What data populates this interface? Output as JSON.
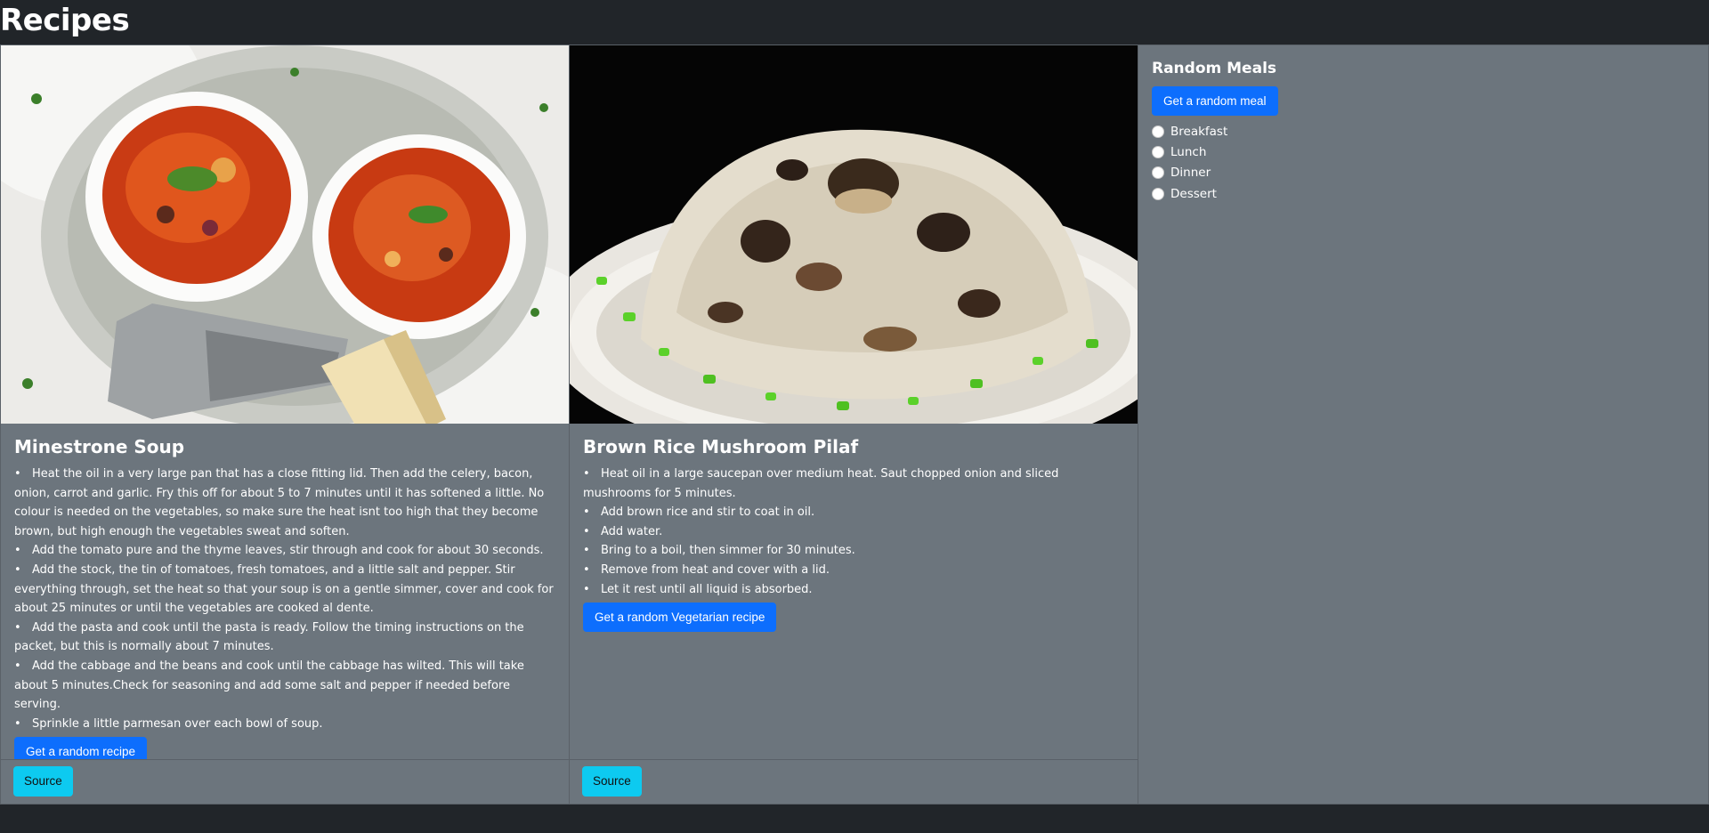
{
  "page": {
    "title": "Recipes"
  },
  "recipes": [
    {
      "title": "Minestrone Soup",
      "image": "minestrone-soup-photo",
      "steps": [
        "Heat the oil in a very large pan that has a close fitting lid. Then add the celery, bacon, onion, carrot and garlic. Fry this off for about 5 to 7 minutes until it has softened a little. No colour is needed on the vegetables, so make sure the heat isnt too high that they become brown, but high enough the vegetables sweat and soften.",
        "Add the tomato pure and the thyme leaves, stir through and cook for about 30 seconds.",
        "Add the stock, the tin of tomatoes, fresh tomatoes, and a little salt and pepper. Stir everything through, set the heat so that your soup is on a gentle simmer, cover and cook for about 25 minutes or until the vegetables are cooked al dente.",
        "Add the pasta and cook until the pasta is ready. Follow the timing instructions on the packet, but this is normally about 7 minutes.",
        "Add the cabbage and the beans and cook until the cabbage has wilted. This will take about 5 minutes.Check for seasoning and add some salt and pepper if needed before serving.",
        "Sprinkle a little parmesan over each bowl of soup."
      ],
      "action_label": "Get a random recipe",
      "source_label": "Source"
    },
    {
      "title": "Brown Rice Mushroom Pilaf",
      "image": "mushroom-pilaf-photo",
      "steps": [
        "Heat oil in a large saucepan over medium heat. Saut chopped onion and sliced mushrooms for 5 minutes.",
        "Add brown rice and stir to coat in oil.",
        "Add water.",
        "Bring to a boil, then simmer for 30 minutes.",
        "Remove from heat and cover with a lid.",
        "Let it rest until all liquid is absorbed."
      ],
      "action_label": "Get a random Vegetarian recipe",
      "source_label": "Source"
    }
  ],
  "random_meals": {
    "title": "Random Meals",
    "button_label": "Get a random meal",
    "options": [
      "Breakfast",
      "Lunch",
      "Dinner",
      "Dessert"
    ]
  },
  "colors": {
    "page_bg": "#212529",
    "card_bg": "#6c757d",
    "primary": "#0d6efd",
    "info": "#0dcaf0"
  }
}
